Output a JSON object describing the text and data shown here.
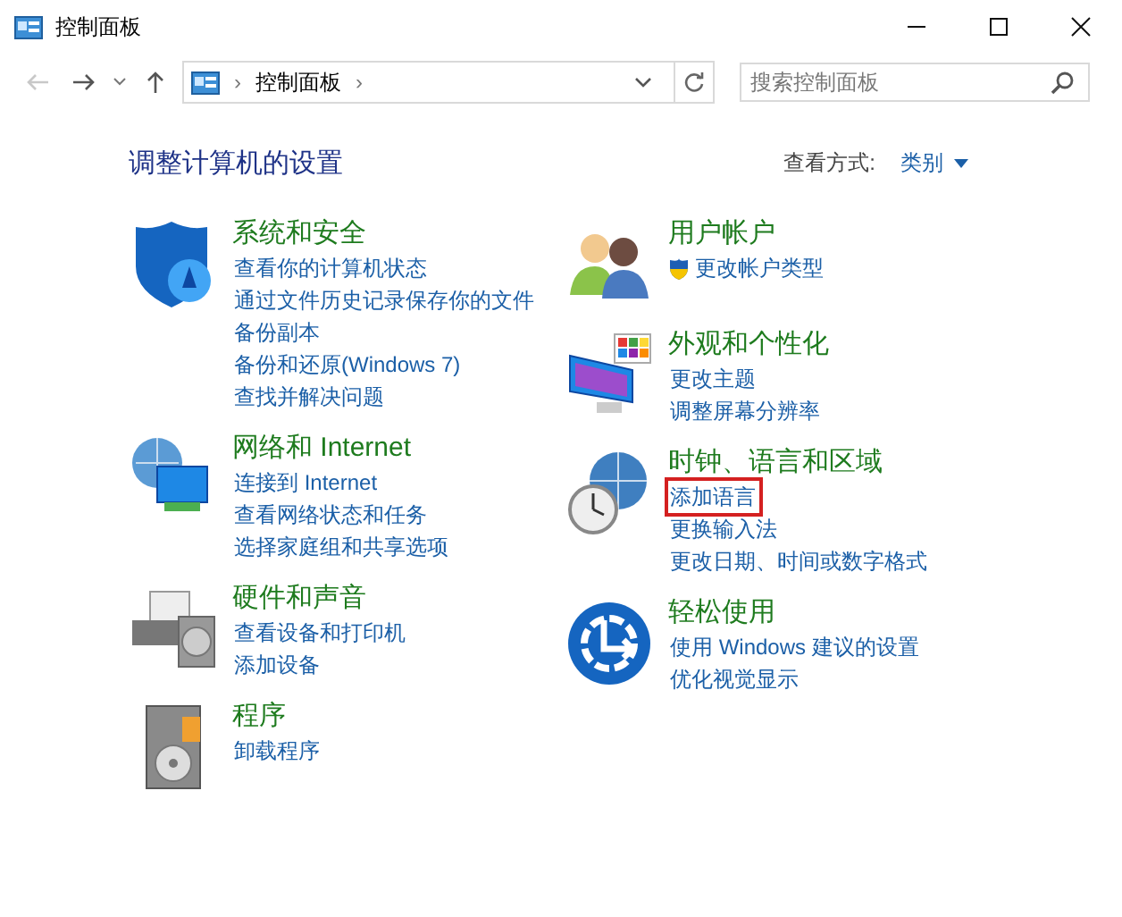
{
  "window": {
    "title": "控制面板"
  },
  "nav": {
    "back_disabled": true,
    "breadcrumb": [
      "›",
      "控制面板",
      "›"
    ]
  },
  "search": {
    "placeholder": "搜索控制面板"
  },
  "heading": "调整计算机的设置",
  "view": {
    "label": "查看方式:",
    "value": "类别"
  },
  "columns": [
    [
      {
        "title": "系统和安全",
        "links": [
          {
            "text": "查看你的计算机状态",
            "shield": false,
            "highlighted": false
          },
          {
            "text": "通过文件历史记录保存你的文件",
            "shield": false,
            "highlighted": false
          },
          {
            "text": "备份副本",
            "shield": false,
            "highlighted": false
          },
          {
            "text": "备份和还原(Windows 7)",
            "shield": false,
            "highlighted": false
          },
          {
            "text": "查找并解决问题",
            "shield": false,
            "highlighted": false
          }
        ]
      },
      {
        "title": "网络和 Internet",
        "links": [
          {
            "text": "连接到 Internet",
            "shield": false,
            "highlighted": false
          },
          {
            "text": "查看网络状态和任务",
            "shield": false,
            "highlighted": false
          },
          {
            "text": "选择家庭组和共享选项",
            "shield": false,
            "highlighted": false
          }
        ]
      },
      {
        "title": "硬件和声音",
        "links": [
          {
            "text": "查看设备和打印机",
            "shield": false,
            "highlighted": false
          },
          {
            "text": "添加设备",
            "shield": false,
            "highlighted": false
          }
        ]
      },
      {
        "title": "程序",
        "links": [
          {
            "text": "卸载程序",
            "shield": false,
            "highlighted": false
          }
        ]
      }
    ],
    [
      {
        "title": "用户帐户",
        "links": [
          {
            "text": "更改帐户类型",
            "shield": true,
            "highlighted": false
          }
        ]
      },
      {
        "title": "外观和个性化",
        "links": [
          {
            "text": "更改主题",
            "shield": false,
            "highlighted": false
          },
          {
            "text": "调整屏幕分辨率",
            "shield": false,
            "highlighted": false
          }
        ]
      },
      {
        "title": "时钟、语言和区域",
        "links": [
          {
            "text": "添加语言",
            "shield": false,
            "highlighted": true
          },
          {
            "text": "更换输入法",
            "shield": false,
            "highlighted": false
          },
          {
            "text": "更改日期、时间或数字格式",
            "shield": false,
            "highlighted": false
          }
        ]
      },
      {
        "title": "轻松使用",
        "links": [
          {
            "text": "使用 Windows 建议的设置",
            "shield": false,
            "highlighted": false
          },
          {
            "text": "优化视觉显示",
            "shield": false,
            "highlighted": false
          }
        ]
      }
    ]
  ]
}
